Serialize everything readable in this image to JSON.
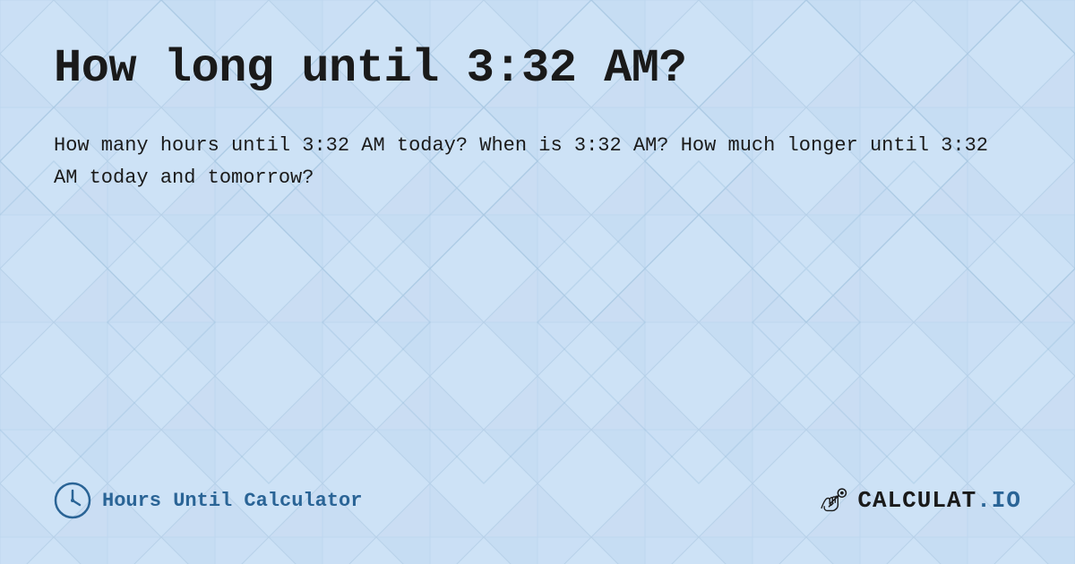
{
  "page": {
    "title": "How long until 3:32 AM?",
    "description": "How many hours until 3:32 AM today? When is 3:32 AM? How much longer until 3:32 AM today and tomorrow?",
    "footer": {
      "brand_label": "Hours Until Calculator",
      "logo_text": "CALCULAT.IO"
    },
    "background": {
      "primary_color": "#c8dff5",
      "secondary_color": "#b8d3ee"
    }
  }
}
